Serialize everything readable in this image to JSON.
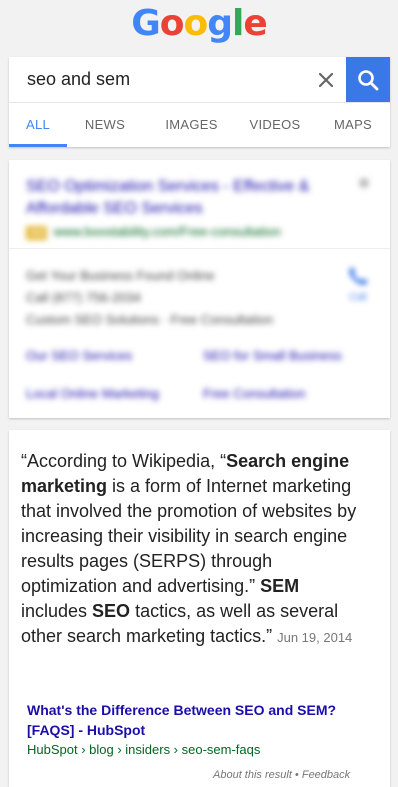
{
  "header": {
    "logo_letters": [
      {
        "char": "G",
        "color": "#4285f4"
      },
      {
        "char": "o",
        "color": "#ea4335"
      },
      {
        "char": "o",
        "color": "#fbbc05"
      },
      {
        "char": "g",
        "color": "#4285f4"
      },
      {
        "char": "l",
        "color": "#34a853"
      },
      {
        "char": "e",
        "color": "#ea4335"
      }
    ]
  },
  "search": {
    "query": "seo and sem",
    "clear_icon": "close-icon",
    "search_icon": "magnifier-icon",
    "accent": "#3b78e7"
  },
  "tabs": [
    {
      "label": "ALL",
      "active": true
    },
    {
      "label": "NEWS",
      "active": false
    },
    {
      "label": "IMAGES",
      "active": false
    },
    {
      "label": "VIDEOS",
      "active": false
    },
    {
      "label": "MAPS",
      "active": false
    }
  ],
  "ad": {
    "title": "SEO Optimization Services - Effective & Affordable SEO Services",
    "badge": "Ad",
    "url": "www.boostability.com/Free-consultation",
    "lines": [
      "Get Your Business Found Online",
      "Call (877) 756-2034",
      "Custom SEO Solutions · Free Consultation"
    ],
    "call_label": "Call",
    "sitelinks": [
      "Our SEO Services",
      "SEO for Small Business",
      "Local Online Marketing",
      "Free Consultation"
    ]
  },
  "answer": {
    "segments": [
      {
        "text": "“According to Wikipedia, “",
        "bold": false
      },
      {
        "text": "Search engine marketing",
        "bold": true
      },
      {
        "text": " is a form of Internet marketing that involved the promotion of websites by increasing their visibility in search engine results pages (SERPS) through optimization and advertising.” ",
        "bold": false
      },
      {
        "text": "SEM",
        "bold": true
      },
      {
        "text": " includes ",
        "bold": false
      },
      {
        "text": "SEO",
        "bold": true
      },
      {
        "text": " tactics, as well as several other search marketing tactics.”",
        "bold": false
      }
    ],
    "date": "Jun 19, 2014",
    "result_title": "What's the Difference Between SEO and SEM? [FAQS] - HubSpot",
    "result_url": "HubSpot › blog › insiders › seo-sem-faqs",
    "about_label": "About this result",
    "separator": " • ",
    "feedback_label": "Feedback"
  }
}
